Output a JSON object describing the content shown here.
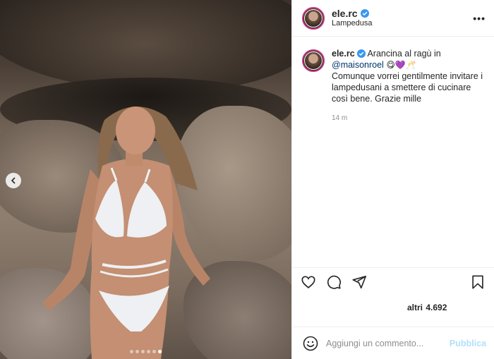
{
  "post": {
    "username": "ele.rc",
    "location": "Lampedusa",
    "more_label": "•••",
    "caption_line1_pre": "Arancina al ragù in",
    "mention": "@maisonroel",
    "emojis": "😋💜🥂",
    "caption_rest": "Comunque vorrei gentilmente invitare i lampedusani a smettere di cucinare così bene. Grazie mille",
    "time": "14 m",
    "likes_prefix": "altri",
    "likes_count": "4.692"
  },
  "comment_box": {
    "placeholder": "Aggiungi un commento...",
    "publish_label": "Pubblica"
  },
  "carousel": {
    "total": 6,
    "active_index": 5
  },
  "colors": {
    "link": "#00376b",
    "verified": "#3897f0",
    "publish_disabled": "#b2dffc",
    "muted": "#8e8e8e"
  }
}
